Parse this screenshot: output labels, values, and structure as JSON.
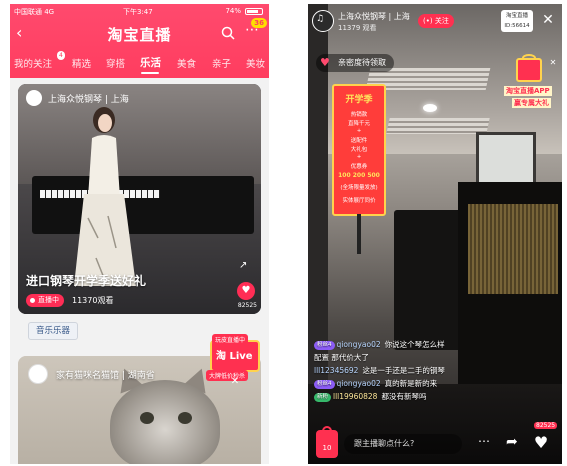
{
  "left": {
    "status": {
      "carrier": "中国联通 4G",
      "time": "下午3:47",
      "battery": "74%"
    },
    "header": {
      "title": "淘宝直播",
      "badge_count": "36"
    },
    "tabs": [
      {
        "label": "我的关注",
        "badge": "4"
      },
      {
        "label": "精选"
      },
      {
        "label": "穿搭"
      },
      {
        "label": "乐活"
      },
      {
        "label": "美食"
      },
      {
        "label": "亲子"
      },
      {
        "label": "美妆"
      }
    ],
    "active_tab": "乐活",
    "card1": {
      "store": "上海众悦钢琴 | 上海",
      "caption": "进口钢琴开学季送好礼",
      "live_label": "直播中",
      "viewers": "11370观看",
      "likes": "82525"
    },
    "category": "音乐乐器",
    "card2": {
      "store": "家有猫咪名猫馆 | 湖南省"
    },
    "promo": {
      "top": "玩皮直播中",
      "mid": "淘 Live",
      "bottom": "大牌低价秒杀"
    }
  },
  "right": {
    "title": "上海众悦钢琴 | 上海",
    "subtitle": "11379 观看",
    "follow_label": "关注",
    "shop_badge_line1": "淘宝直播",
    "shop_badge_line2": "ID:56614",
    "notice": "亲密度待领取",
    "poster": {
      "title": "开学季",
      "line1": "热销款",
      "line2": "直降千元",
      "line3": "+",
      "line4": "送配件",
      "line5": "大礼包",
      "line6": "+",
      "line7": "优惠券",
      "big": "100 200 500",
      "line8": "(全场限量发放)",
      "line9": "实体展厅同价"
    },
    "promo": {
      "line1": "淘宝直播APP",
      "line2": "赢专属大礼"
    },
    "chat": [
      {
        "level": "粉丝4",
        "level_color": "purple",
        "user": "qiongyao02",
        "msg": "你说这个琴怎么样"
      },
      {
        "level": "",
        "level_color": "",
        "user": "",
        "msg": "配置 那代价大了"
      },
      {
        "level": "",
        "level_color": "",
        "user": "lll12345692",
        "msg": "这是一手还是二手的钢琴"
      },
      {
        "level": "粉丝4",
        "level_color": "purple",
        "user": "qiongyao02",
        "msg": "真的新是新的来"
      },
      {
        "level": "新粉",
        "level_color": "green",
        "user": "lll19960828",
        "msg": "都没有新琴吗"
      }
    ],
    "bag_count": "10",
    "input_placeholder": "跟主播聊点什么?",
    "like_count": "82525"
  }
}
